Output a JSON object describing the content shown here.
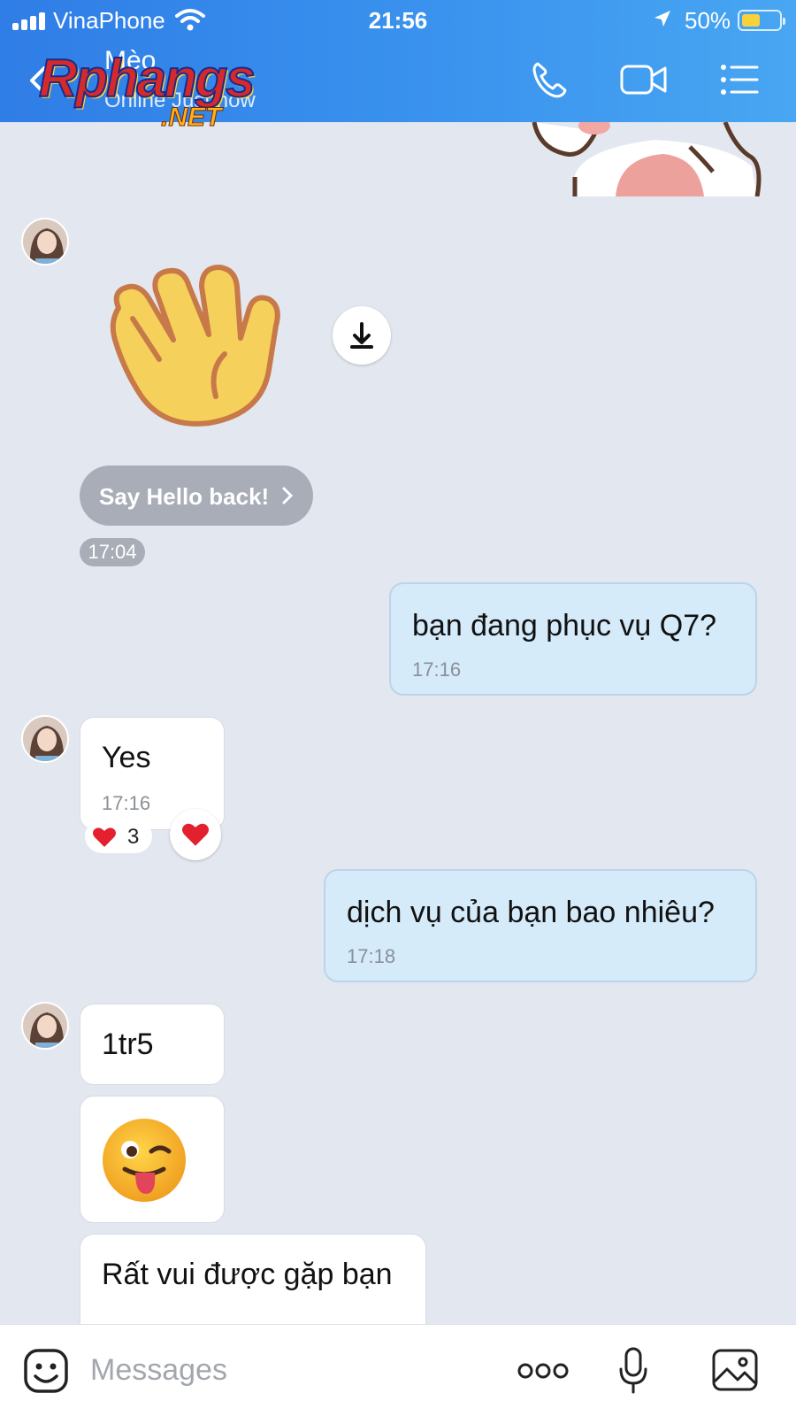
{
  "status_bar": {
    "carrier": "VinaPhone",
    "time": "21:56",
    "battery": "50%",
    "battery_level": 0.5
  },
  "header": {
    "contact_name": "Mèo",
    "contact_status": "Online Just now",
    "watermark_main": "Rphangs",
    "watermark_sub": ".NET",
    "icons": [
      "back-icon",
      "phone-icon",
      "video-icon",
      "menu-icon"
    ]
  },
  "messages": [
    {
      "id": "sticker-bunny",
      "direction": "in",
      "type": "sticker"
    },
    {
      "id": "wave",
      "direction": "in",
      "type": "sticker",
      "emoji": "👋"
    },
    {
      "id": "say-hello",
      "type": "action",
      "label": "Say Hello back!",
      "time": "17:04"
    },
    {
      "id": "m1",
      "direction": "out",
      "text": "bạn đang phục vụ Q7?",
      "time": "17:16"
    },
    {
      "id": "m2",
      "direction": "in",
      "text": "Yes",
      "time": "17:16",
      "reaction_count": "3"
    },
    {
      "id": "m3",
      "direction": "out",
      "text": "dịch vụ của bạn bao nhiêu?",
      "time": "17:18"
    },
    {
      "id": "m4",
      "direction": "in",
      "text": "1tr5"
    },
    {
      "id": "m5",
      "direction": "in",
      "type": "sticker",
      "emoji": "😜"
    },
    {
      "id": "m6",
      "direction": "in",
      "text": "Rất vui được gặp bạn"
    }
  ],
  "composer": {
    "placeholder": "Messages",
    "icons": [
      "emoji-icon",
      "more-icon",
      "microphone-icon",
      "image-icon"
    ]
  },
  "colors": {
    "header_start": "#2f7de6",
    "header_end": "#48a6f2",
    "chat_bg": "#e3e7ef",
    "outgoing_bubble": "#d5ebfa",
    "incoming_bubble": "#ffffff"
  }
}
